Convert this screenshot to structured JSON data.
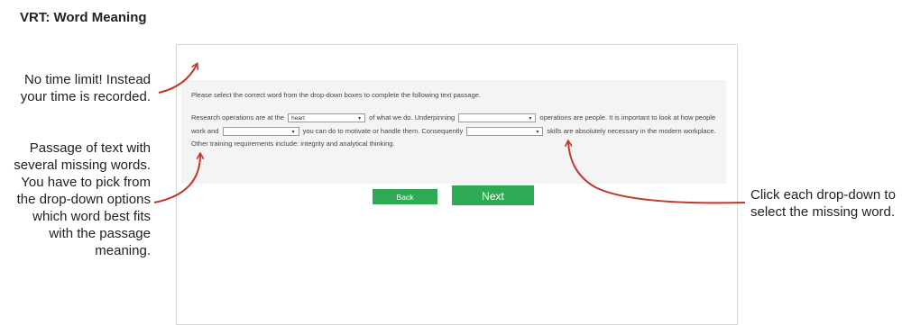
{
  "heading": "VRT: Word Meaning",
  "annotations": {
    "time": "No time limit! Instead your time is recorded.",
    "passage": "Passage of text with several missing words. You have to pick from the drop-down options which word best fits with the passage meaning.",
    "dropdown": "Click each drop-down to select the missing word."
  },
  "test": {
    "instruction": "Please select the correct word from the drop-down boxes to complete the following text passage.",
    "passage": {
      "seg1": "Research operations are at the",
      "dd1_value": "heart",
      "seg2": "of what we do. Underpinning",
      "dd2_value": "",
      "seg3": "operations are people. It is important to look at how people work and",
      "dd3_value": "",
      "seg4": "you can do to motivate or handle them. Consequently",
      "dd4_value": "",
      "seg5": "skills are absolutely necessary in the modern workplace. Other training requirements include: integrity and analytical thinking."
    },
    "back_label": "Back",
    "next_label": "Next"
  },
  "colors": {
    "button": "#2eaa55",
    "arrow": "#c0392b"
  }
}
